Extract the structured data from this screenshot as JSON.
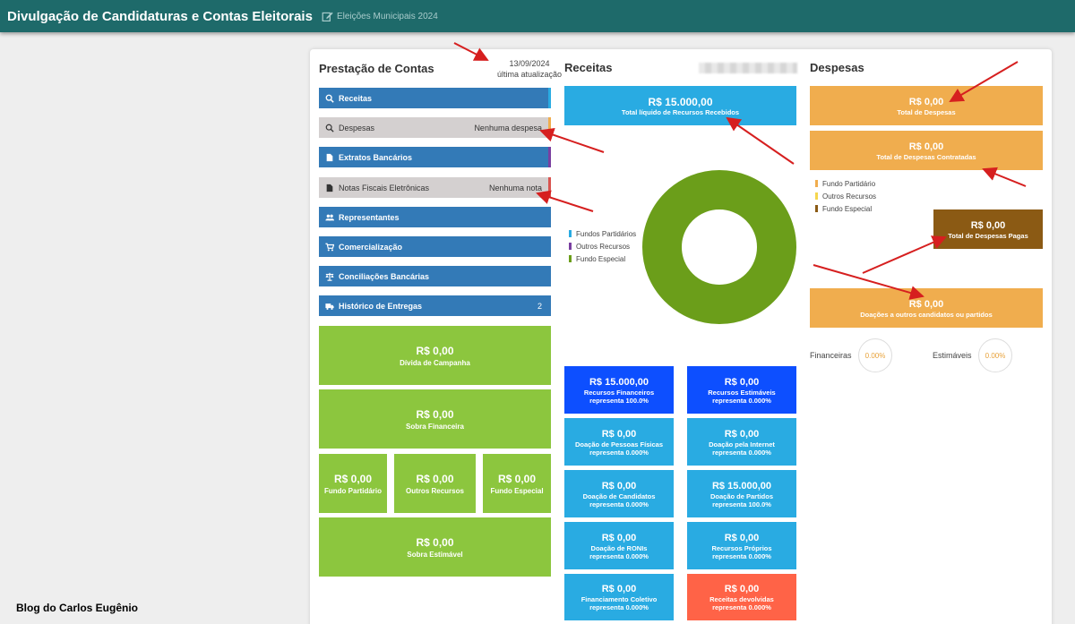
{
  "header": {
    "title": "Divulgação de Candidaturas e Contas Eleitorais",
    "subtitle": "Eleições Municipais 2024"
  },
  "prestacao": {
    "title": "Prestação de Contas",
    "date": "13/09/2024",
    "date_caption": "última atualização",
    "buttons": [
      {
        "label": "Receitas",
        "right": "",
        "icon": "search-icon"
      },
      {
        "label": "Despesas",
        "right": "Nenhuma despesa",
        "icon": "search-icon"
      },
      {
        "label": "Extratos Bancários",
        "right": "",
        "icon": "file-icon"
      },
      {
        "label": "Notas Fiscais Eletrônicas",
        "right": "Nenhuma nota",
        "icon": "file-icon"
      },
      {
        "label": "Representantes",
        "right": "",
        "icon": "users-icon"
      },
      {
        "label": "Comercialização",
        "right": "",
        "icon": "cart-icon"
      },
      {
        "label": "Conciliações Bancárias",
        "right": "",
        "icon": "balance-icon"
      },
      {
        "label": "Histórico de Entregas",
        "right": "2",
        "icon": "truck-icon"
      }
    ],
    "divida": {
      "value": "R$ 0,00",
      "label": "Dívida de Campanha"
    },
    "sobra_financeira": {
      "value": "R$ 0,00",
      "label": "Sobra Financeira"
    },
    "fundos": [
      {
        "value": "R$ 0,00",
        "label": "Fundo Partidário"
      },
      {
        "value": "R$ 0,00",
        "label": "Outros Recursos"
      },
      {
        "value": "R$ 0,00",
        "label": "Fundo Especial"
      }
    ],
    "sobra_estimavel": {
      "value": "R$ 0,00",
      "label": "Sobra Estimável"
    }
  },
  "receitas": {
    "title": "Receitas",
    "total": {
      "value": "R$ 15.000,00",
      "label": "Total líquido de Recursos Recebidos"
    },
    "legend": [
      "Fundos Partidários",
      "Outros Recursos",
      "Fundo Especial"
    ],
    "tiles": [
      {
        "value": "R$ 15.000,00",
        "label": "Recursos Financeiros",
        "pct": "representa 100.0%"
      },
      {
        "value": "R$ 0,00",
        "label": "Recursos Estimáveis",
        "pct": "representa 0.000%"
      },
      {
        "value": "R$ 0,00",
        "label": "Doação de Pessoas Físicas",
        "pct": "representa 0.000%"
      },
      {
        "value": "R$ 0,00",
        "label": "Doação pela Internet",
        "pct": "representa 0.000%"
      },
      {
        "value": "R$ 0,00",
        "label": "Doação de Candidatos",
        "pct": "representa 0.000%"
      },
      {
        "value": "R$ 15.000,00",
        "label": "Doação de Partidos",
        "pct": "representa 100.0%"
      },
      {
        "value": "R$ 0,00",
        "label": "Doação de RONIs",
        "pct": "representa 0.000%"
      },
      {
        "value": "R$ 0,00",
        "label": "Recursos Próprios",
        "pct": "representa 0.000%"
      },
      {
        "value": "R$ 0,00",
        "label": "Financiamento Coletivo",
        "pct": "representa 0.000%"
      },
      {
        "value": "R$ 0,00",
        "label": "Receitas devolvidas",
        "pct": "representa 0.000%"
      }
    ]
  },
  "despesas": {
    "title": "Despesas",
    "total": {
      "value": "R$ 0,00",
      "label": "Total de Despesas"
    },
    "contratadas": {
      "value": "R$ 0,00",
      "label": "Total de Despesas Contratadas"
    },
    "legend": [
      "Fundo Partidário",
      "Outros Recursos",
      "Fundo Especial"
    ],
    "pagas": {
      "value": "R$ 0,00",
      "label": "Total de Despesas Pagas"
    },
    "doacoes": {
      "value": "R$ 0,00",
      "label": "Doações a outros candidatos ou partidos"
    },
    "financeiras": {
      "label": "Financeiras",
      "value": "0.00%"
    },
    "estimaveis": {
      "label": "Estimáveis",
      "value": "0.00%"
    }
  },
  "footer": "Blog do Carlos Eugênio",
  "colors": {
    "header": "#1e6a6a",
    "nav_blue": "#337ab7",
    "green": "#8cc63e",
    "cyan": "#29abe2",
    "deep_blue": "#0d4fff",
    "orange": "#f0ad4e",
    "brown": "#8b5a14",
    "red_tile": "#ff6347",
    "donut": "#6b9e1a"
  }
}
